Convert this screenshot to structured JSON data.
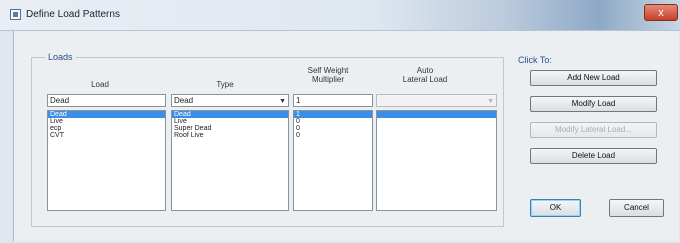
{
  "window": {
    "title": "Define Load Patterns",
    "close_glyph": "x"
  },
  "loads": {
    "group_title": "Loads",
    "headers": {
      "load": "Load",
      "type": "Type",
      "self_weight_line1": "Self Weight",
      "self_weight_line2": "Multiplier",
      "auto_line1": "Auto",
      "auto_line2": "Lateral Load"
    },
    "current": {
      "name": "Dead",
      "type": "Dead",
      "multiplier": "1",
      "auto_lateral": ""
    },
    "rows": [
      {
        "name": "Dead",
        "type": "Dead",
        "multiplier": "1",
        "selected": true
      },
      {
        "name": "Live",
        "type": "Live",
        "multiplier": "0",
        "selected": false
      },
      {
        "name": "ecp",
        "type": "Super Dead",
        "multiplier": "0",
        "selected": false
      },
      {
        "name": "CVT",
        "type": "Roof Live",
        "multiplier": "0",
        "selected": false
      }
    ]
  },
  "actions": {
    "title": "Click To:",
    "add": "Add New Load",
    "modify": "Modify Load",
    "modify_lateral": "Modify Lateral Load...",
    "delete": "Delete Load"
  },
  "footer": {
    "ok": "OK",
    "cancel": "Cancel"
  },
  "icons": {
    "app": "app-icon",
    "dropdown": "chevron-down-icon"
  },
  "colors": {
    "selection": "#3d8ee6",
    "group_title": "#2a4f8a"
  }
}
